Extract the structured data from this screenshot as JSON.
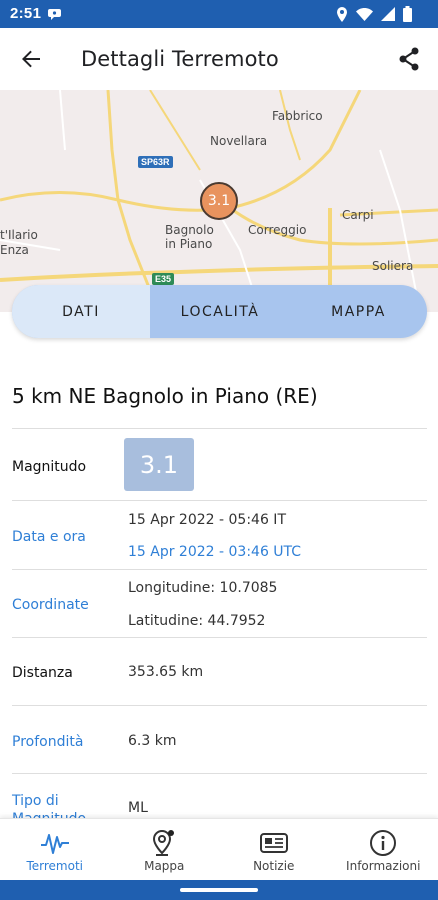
{
  "status_bar": {
    "time": "2:51"
  },
  "app_bar": {
    "title": "Dettagli Terremoto"
  },
  "map": {
    "labels": {
      "fabbrico": "Fabbrico",
      "novellara": "Novellara",
      "carpi": "Carpi",
      "correggio": "Correggio",
      "bagnolo": "Bagnolo\nin Piano",
      "soliera": "Soliera",
      "sant_ilario": "t'Ilario",
      "enza": "Enza"
    },
    "road_badges": {
      "sp63r": "SP63R",
      "e35": "E35"
    },
    "marker_value": "3.1",
    "colors": {
      "marker": "#e8935e",
      "road": "#f5d77a",
      "background": "#f2ecec"
    }
  },
  "tabs": [
    {
      "label": "DATI",
      "active": true
    },
    {
      "label": "LOCALITÀ",
      "active": false
    },
    {
      "label": "MAPPA",
      "active": false
    }
  ],
  "quake": {
    "title": "5 km NE Bagnolo in Piano (RE)",
    "rows": {
      "magnitude": {
        "label": "Magnitudo",
        "value": "3.1"
      },
      "datetime": {
        "label": "Data e ora",
        "local": "15 Apr 2022 - 05:46 IT",
        "utc": "15 Apr 2022 - 03:46 UTC"
      },
      "coordinates": {
        "label": "Coordinate",
        "longitude": "Longitudine: 10.7085",
        "latitude": "Latitudine: 44.7952"
      },
      "distance": {
        "label": "Distanza",
        "value": "353.65 km"
      },
      "depth": {
        "label": "Profondità",
        "value": "6.3 km"
      },
      "mag_type": {
        "label": "Tipo di\nMagnitudo",
        "value": "ML"
      }
    }
  },
  "bottom_nav": [
    {
      "label": "Terremoti",
      "icon": "earthquake-icon",
      "active": true
    },
    {
      "label": "Mappa",
      "icon": "map-pin-icon",
      "active": false
    },
    {
      "label": "Notizie",
      "icon": "news-icon",
      "active": false
    },
    {
      "label": "Informazioni",
      "icon": "info-icon",
      "active": false
    }
  ],
  "colors": {
    "primary": "#1f5fb0",
    "accent": "#2f7fd6",
    "tab_bg": "#a8c5ee",
    "tab_active": "#dbe8f8"
  }
}
